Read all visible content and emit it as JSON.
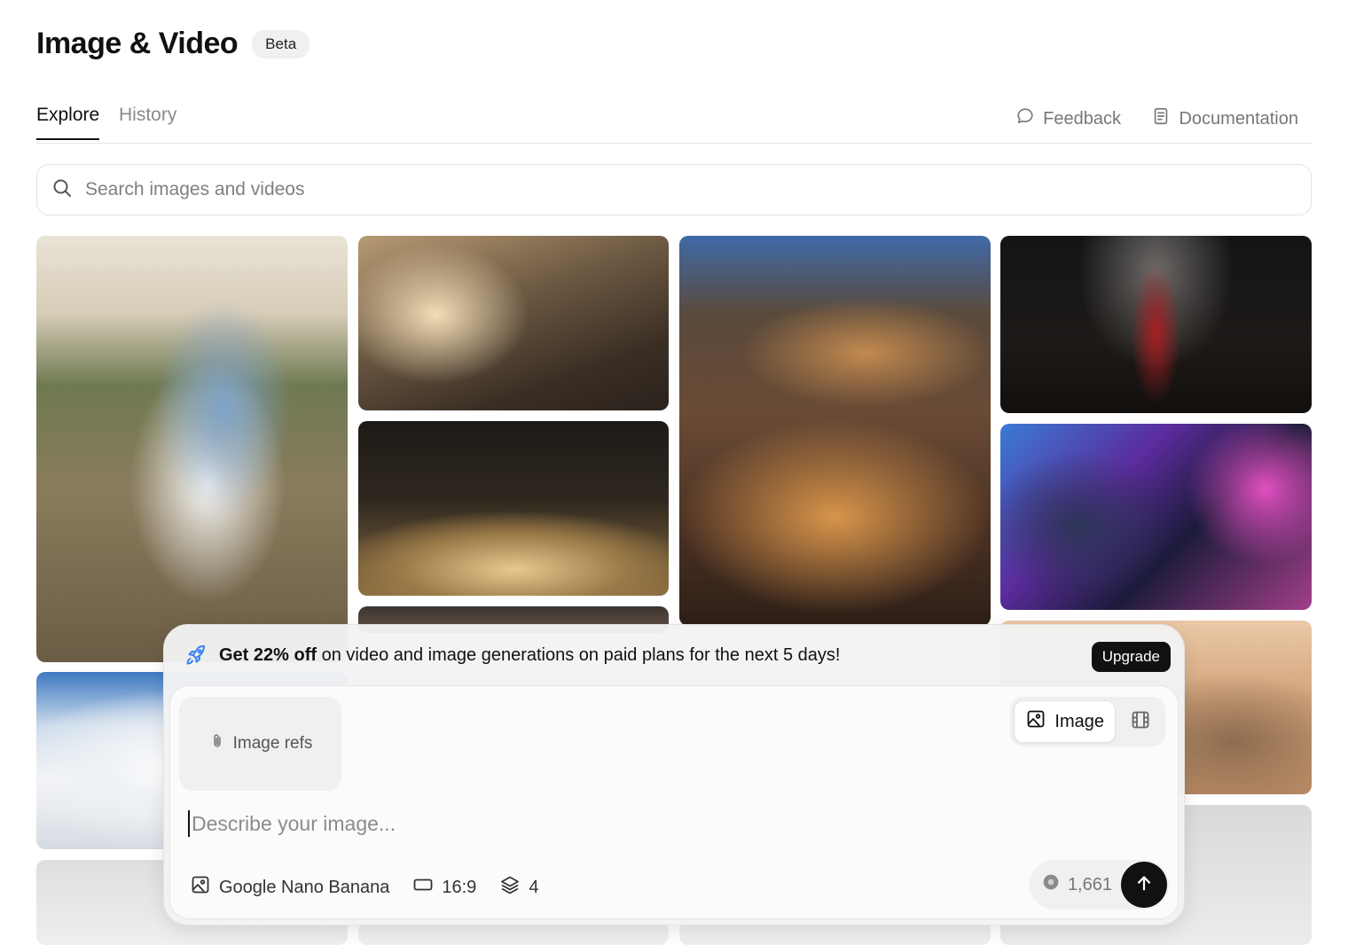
{
  "header": {
    "title": "Image & Video",
    "badge": "Beta"
  },
  "tabs": [
    {
      "label": "Explore",
      "active": true
    },
    {
      "label": "History",
      "active": false
    }
  ],
  "top_links": {
    "feedback": "Feedback",
    "documentation": "Documentation"
  },
  "search": {
    "placeholder": "Search images and videos",
    "value": ""
  },
  "promo": {
    "bold_text": "Get 22% off",
    "text": " on video and image generations on paid plans for the next 5 days!",
    "upgrade_label": "Upgrade"
  },
  "composer": {
    "image_refs_label": "Image refs",
    "mode_image_label": "Image",
    "prompt_placeholder": "Describe your image...",
    "model": "Google Nano Banana",
    "aspect_ratio": "16:9",
    "count": "4",
    "credits": "1,661"
  },
  "colors": {
    "accent": "#111111",
    "muted": "#808080",
    "panel": "#f2f2f2"
  },
  "icons": [
    "search-icon",
    "chat-bubble-icon",
    "document-icon",
    "rocket-icon",
    "paperclip-icon",
    "image-icon",
    "film-icon",
    "aspect-ratio-icon",
    "layers-icon",
    "credit-coin-icon",
    "arrow-up-icon"
  ]
}
